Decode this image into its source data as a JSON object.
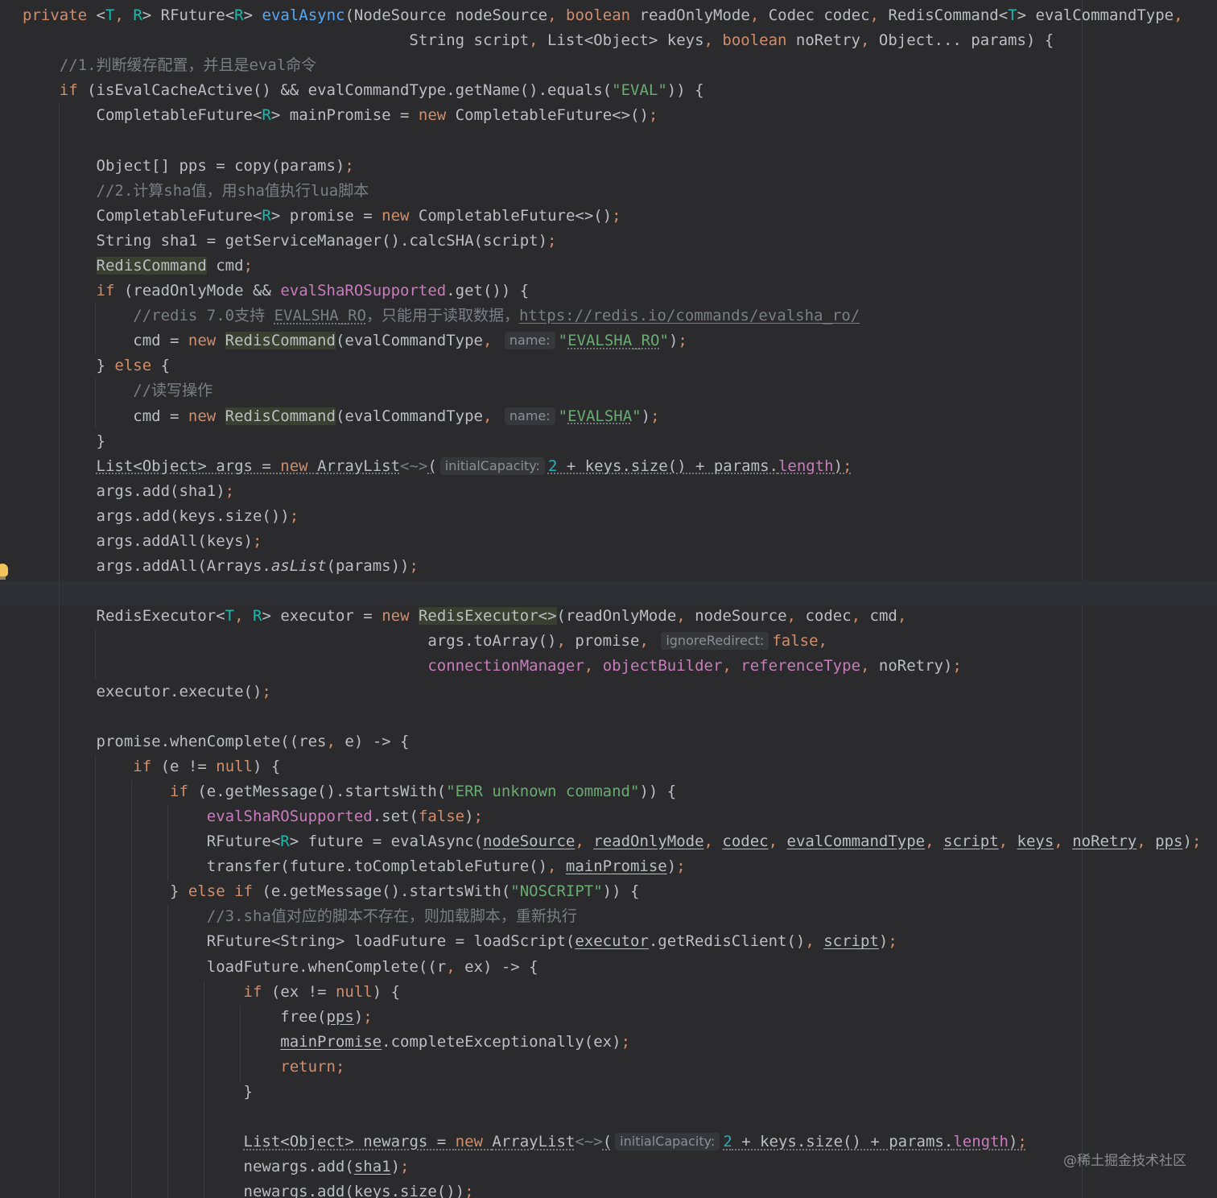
{
  "watermark": "@稀土掘金技术社区",
  "lines": [
    [
      [
        "private ",
        "kw"
      ],
      [
        "<",
        "punc"
      ],
      [
        "T",
        "tp"
      ],
      [
        ", ",
        "kw"
      ],
      [
        "R",
        "tp"
      ],
      [
        "> RFuture<",
        "punc"
      ],
      [
        "R",
        "tp"
      ],
      [
        "> ",
        "punc"
      ],
      [
        "evalAsync",
        "fn"
      ],
      [
        "(NodeSource nodeSource",
        ""
      ],
      [
        ", ",
        "kw"
      ],
      [
        "boolean",
        "kw"
      ],
      [
        " readOnlyMode",
        ""
      ],
      [
        ", ",
        "kw"
      ],
      [
        "Codec codec",
        ""
      ],
      [
        ", ",
        "kw"
      ],
      [
        "RedisCommand<",
        ""
      ],
      [
        "T",
        "tp"
      ],
      [
        "> evalCommandType",
        ""
      ],
      [
        ",",
        "kw"
      ]
    ],
    [
      [
        "                                          String script",
        ""
      ],
      [
        ", ",
        "kw"
      ],
      [
        "List<Object> keys",
        ""
      ],
      [
        ", ",
        "kw"
      ],
      [
        "boolean",
        "kw"
      ],
      [
        " noRetry",
        ""
      ],
      [
        ", ",
        "kw"
      ],
      [
        "Object... params) {",
        ""
      ]
    ],
    [
      [
        "    ",
        ""
      ],
      [
        "//1.判断缓存配置，并且是eval命令",
        "cmt"
      ]
    ],
    [
      [
        "    ",
        ""
      ],
      [
        "if",
        "kw"
      ],
      [
        " (isEvalCacheActive() && evalCommandType.getName().equals(",
        ""
      ],
      [
        "\"EVAL\"",
        "str"
      ],
      [
        ")) {",
        ""
      ]
    ],
    [
      [
        "        CompletableFuture<",
        ""
      ],
      [
        "R",
        "tp"
      ],
      [
        "> mainPromise = ",
        ""
      ],
      [
        "new",
        "kw"
      ],
      [
        " CompletableFuture<>()",
        ""
      ],
      [
        ";",
        "kw"
      ]
    ],
    [
      [
        "",
        ""
      ]
    ],
    [
      [
        "        Object[] pps = copy(params)",
        ""
      ],
      [
        ";",
        "kw"
      ]
    ],
    [
      [
        "        ",
        ""
      ],
      [
        "//2.计算sha值，用sha值执行lua脚本",
        "cmt"
      ]
    ],
    [
      [
        "        CompletableFuture<",
        ""
      ],
      [
        "R",
        "tp"
      ],
      [
        "> promise = ",
        ""
      ],
      [
        "new",
        "kw"
      ],
      [
        " CompletableFuture<>()",
        ""
      ],
      [
        ";",
        "kw"
      ]
    ],
    [
      [
        "        String sha1 = getServiceManager().calcSHA(script)",
        ""
      ],
      [
        ";",
        "kw"
      ]
    ],
    [
      [
        "        ",
        ""
      ],
      [
        "RedisCommand",
        "hl"
      ],
      [
        " cmd",
        ""
      ],
      [
        ";",
        "kw"
      ]
    ],
    [
      [
        "        ",
        ""
      ],
      [
        "if",
        "kw"
      ],
      [
        " (readOnlyMode && ",
        ""
      ],
      [
        "evalShaROSupported",
        "fld"
      ],
      [
        ".get()) {",
        ""
      ]
    ],
    [
      [
        "            ",
        ""
      ],
      [
        "//redis 7.0支持 ",
        "cmt"
      ],
      [
        "EVALSHA_RO",
        "cmt wavy"
      ],
      [
        "，只能用于读取数据，",
        "cmt"
      ],
      [
        "https://redis.io/commands/evalsha_ro/",
        "link"
      ]
    ],
    [
      [
        "            cmd = ",
        ""
      ],
      [
        "new ",
        "kw"
      ],
      [
        "RedisCommand",
        "hl"
      ],
      [
        "(evalCommandType",
        ""
      ],
      [
        ", ",
        "kw"
      ],
      [
        "name:",
        "hint"
      ],
      [
        "\"",
        "str"
      ],
      [
        "EVALSHA_RO",
        "str wavy"
      ],
      [
        "\"",
        "str"
      ],
      [
        ")",
        ""
      ],
      [
        ";",
        "kw"
      ]
    ],
    [
      [
        "        } ",
        ""
      ],
      [
        "else",
        "kw"
      ],
      [
        " {",
        ""
      ]
    ],
    [
      [
        "            ",
        ""
      ],
      [
        "//读写操作",
        "cmt"
      ]
    ],
    [
      [
        "            cmd = ",
        ""
      ],
      [
        "new ",
        "kw"
      ],
      [
        "RedisCommand",
        "hl"
      ],
      [
        "(evalCommandType",
        ""
      ],
      [
        ", ",
        "kw"
      ],
      [
        "name:",
        "hint"
      ],
      [
        "\"",
        "str"
      ],
      [
        "EVALSHA",
        "str wavy"
      ],
      [
        "\"",
        "str"
      ],
      [
        ")",
        ""
      ],
      [
        ";",
        "kw"
      ]
    ],
    [
      [
        "        }",
        ""
      ]
    ],
    [
      [
        "        ",
        ""
      ],
      [
        "List<Object> args = ",
        "wavy"
      ],
      [
        "new ",
        "kw wavy"
      ],
      [
        "ArrayList",
        "wavy"
      ],
      [
        "<~>",
        "cmt"
      ],
      [
        "(",
        "wavy"
      ],
      [
        "initialCapacity:",
        "hint"
      ],
      [
        "2",
        "num wavy"
      ],
      [
        " + keys.size() + params.",
        "wavy"
      ],
      [
        "length",
        "fld wavy"
      ],
      [
        ")",
        "wavy"
      ],
      [
        ";",
        "kw wavy"
      ]
    ],
    [
      [
        "        args.add(sha1)",
        ""
      ],
      [
        ";",
        "kw"
      ]
    ],
    [
      [
        "        args.add(keys.size())",
        ""
      ],
      [
        ";",
        "kw"
      ]
    ],
    [
      [
        "        args.addAll(keys)",
        ""
      ],
      [
        ";",
        "kw"
      ]
    ],
    [
      [
        "        args.addAll(Arrays.",
        ""
      ],
      [
        "asList",
        "stat"
      ],
      [
        "(params))",
        ""
      ],
      [
        ";",
        "kw"
      ]
    ],
    [
      [
        "",
        ""
      ]
    ],
    [
      [
        "        RedisExecutor<",
        ""
      ],
      [
        "T",
        "tp"
      ],
      [
        ", ",
        "kw"
      ],
      [
        "R",
        "tp"
      ],
      [
        "> executor = ",
        ""
      ],
      [
        "new ",
        "kw"
      ],
      [
        "RedisExecutor<>",
        "hl"
      ],
      [
        "(readOnlyMode",
        ""
      ],
      [
        ", ",
        "kw"
      ],
      [
        "nodeSource",
        ""
      ],
      [
        ", ",
        "kw"
      ],
      [
        "codec",
        ""
      ],
      [
        ", ",
        "kw"
      ],
      [
        "cmd",
        ""
      ],
      [
        ",",
        "kw"
      ]
    ],
    [
      [
        "                                            args.toArray()",
        ""
      ],
      [
        ", ",
        "kw"
      ],
      [
        "promise",
        ""
      ],
      [
        ", ",
        "kw"
      ],
      [
        "ignoreRedirect:",
        "hint"
      ],
      [
        "false",
        "kw"
      ],
      [
        ",",
        "kw"
      ]
    ],
    [
      [
        "                                            ",
        ""
      ],
      [
        "connectionManager",
        "fld"
      ],
      [
        ", ",
        "kw"
      ],
      [
        "objectBuilder",
        "fld"
      ],
      [
        ", ",
        "kw"
      ],
      [
        "referenceType",
        "fld"
      ],
      [
        ", ",
        "kw"
      ],
      [
        "noRetry)",
        ""
      ],
      [
        ";",
        "kw"
      ]
    ],
    [
      [
        "        executor.execute()",
        ""
      ],
      [
        ";",
        "kw"
      ]
    ],
    [
      [
        "",
        ""
      ]
    ],
    [
      [
        "        promise.whenComplete((res",
        ""
      ],
      [
        ", ",
        "kw"
      ],
      [
        "e) -> {",
        ""
      ]
    ],
    [
      [
        "            ",
        ""
      ],
      [
        "if",
        "kw"
      ],
      [
        " (e != ",
        ""
      ],
      [
        "null",
        "kw"
      ],
      [
        ") {",
        ""
      ]
    ],
    [
      [
        "                ",
        ""
      ],
      [
        "if",
        "kw"
      ],
      [
        " (e.getMessage().startsWith(",
        ""
      ],
      [
        "\"ERR unknown command\"",
        "str"
      ],
      [
        ")) {",
        ""
      ]
    ],
    [
      [
        "                    ",
        ""
      ],
      [
        "evalShaROSupported",
        "fld"
      ],
      [
        ".set(",
        ""
      ],
      [
        "false",
        "kw"
      ],
      [
        ")",
        ""
      ],
      [
        ";",
        "kw"
      ]
    ],
    [
      [
        "                    RFuture<",
        ""
      ],
      [
        "R",
        "tp"
      ],
      [
        "> future = evalAsync(",
        ""
      ],
      [
        "nodeSource",
        "uline"
      ],
      [
        ", ",
        "kw"
      ],
      [
        "readOnlyMode",
        "uline"
      ],
      [
        ", ",
        "kw"
      ],
      [
        "codec",
        "uline"
      ],
      [
        ", ",
        "kw"
      ],
      [
        "evalCommandType",
        "uline"
      ],
      [
        ", ",
        "kw"
      ],
      [
        "script",
        "uline"
      ],
      [
        ", ",
        "kw"
      ],
      [
        "keys",
        "uline"
      ],
      [
        ", ",
        "kw"
      ],
      [
        "noRetry",
        "uline"
      ],
      [
        ", ",
        "kw"
      ],
      [
        "pps",
        "uline"
      ],
      [
        ")",
        ""
      ],
      [
        ";",
        "kw"
      ]
    ],
    [
      [
        "                    transfer(future.toCompletableFuture()",
        ""
      ],
      [
        ", ",
        "kw"
      ],
      [
        "mainPromise",
        "uline"
      ],
      [
        ")",
        ""
      ],
      [
        ";",
        "kw"
      ]
    ],
    [
      [
        "                } ",
        ""
      ],
      [
        "else if",
        "kw"
      ],
      [
        " (e.getMessage().startsWith(",
        ""
      ],
      [
        "\"NOSCRIPT\"",
        "str"
      ],
      [
        ")) {",
        ""
      ]
    ],
    [
      [
        "                    ",
        ""
      ],
      [
        "//3.sha值对应的脚本不存在，则加载脚本，重新执行",
        "cmt"
      ]
    ],
    [
      [
        "                    RFuture<String> loadFuture = loadScript(",
        ""
      ],
      [
        "executor",
        "uline"
      ],
      [
        ".getRedisClient()",
        ""
      ],
      [
        ", ",
        "kw"
      ],
      [
        "script",
        "uline"
      ],
      [
        ")",
        ""
      ],
      [
        ";",
        "kw"
      ]
    ],
    [
      [
        "                    loadFuture.whenComplete((r",
        ""
      ],
      [
        ", ",
        "kw"
      ],
      [
        "ex) -> {",
        ""
      ]
    ],
    [
      [
        "                        ",
        ""
      ],
      [
        "if",
        "kw"
      ],
      [
        " (ex != ",
        ""
      ],
      [
        "null",
        "kw"
      ],
      [
        ") {",
        ""
      ]
    ],
    [
      [
        "                            free(",
        ""
      ],
      [
        "pps",
        "uline"
      ],
      [
        ")",
        ""
      ],
      [
        ";",
        "kw"
      ]
    ],
    [
      [
        "                            ",
        ""
      ],
      [
        "mainPromise",
        "uline"
      ],
      [
        ".completeExceptionally(ex)",
        ""
      ],
      [
        ";",
        "kw"
      ]
    ],
    [
      [
        "                            ",
        ""
      ],
      [
        "return",
        "kw"
      ],
      [
        ";",
        "kw"
      ]
    ],
    [
      [
        "                        }",
        ""
      ]
    ],
    [
      [
        "",
        ""
      ]
    ],
    [
      [
        "                        ",
        ""
      ],
      [
        "List<Object> newargs = ",
        "wavy"
      ],
      [
        "new ",
        "kw wavy"
      ],
      [
        "ArrayList",
        "wavy"
      ],
      [
        "<~>",
        "cmt"
      ],
      [
        "(",
        "wavy"
      ],
      [
        "initialCapacity:",
        "hint"
      ],
      [
        "2",
        "num wavy"
      ],
      [
        " + keys.size() + params.",
        "wavy"
      ],
      [
        "length",
        "fld wavy"
      ],
      [
        ")",
        "wavy"
      ],
      [
        ";",
        "kw wavy"
      ]
    ],
    [
      [
        "                        newargs.add(",
        ""
      ],
      [
        "sha1",
        "uline"
      ],
      [
        ")",
        ""
      ],
      [
        ";",
        "kw"
      ]
    ],
    [
      [
        "                        newargs.add(",
        ""
      ],
      [
        "keys",
        "uline"
      ],
      [
        ".size())",
        ""
      ],
      [
        ";",
        "kw"
      ]
    ]
  ]
}
